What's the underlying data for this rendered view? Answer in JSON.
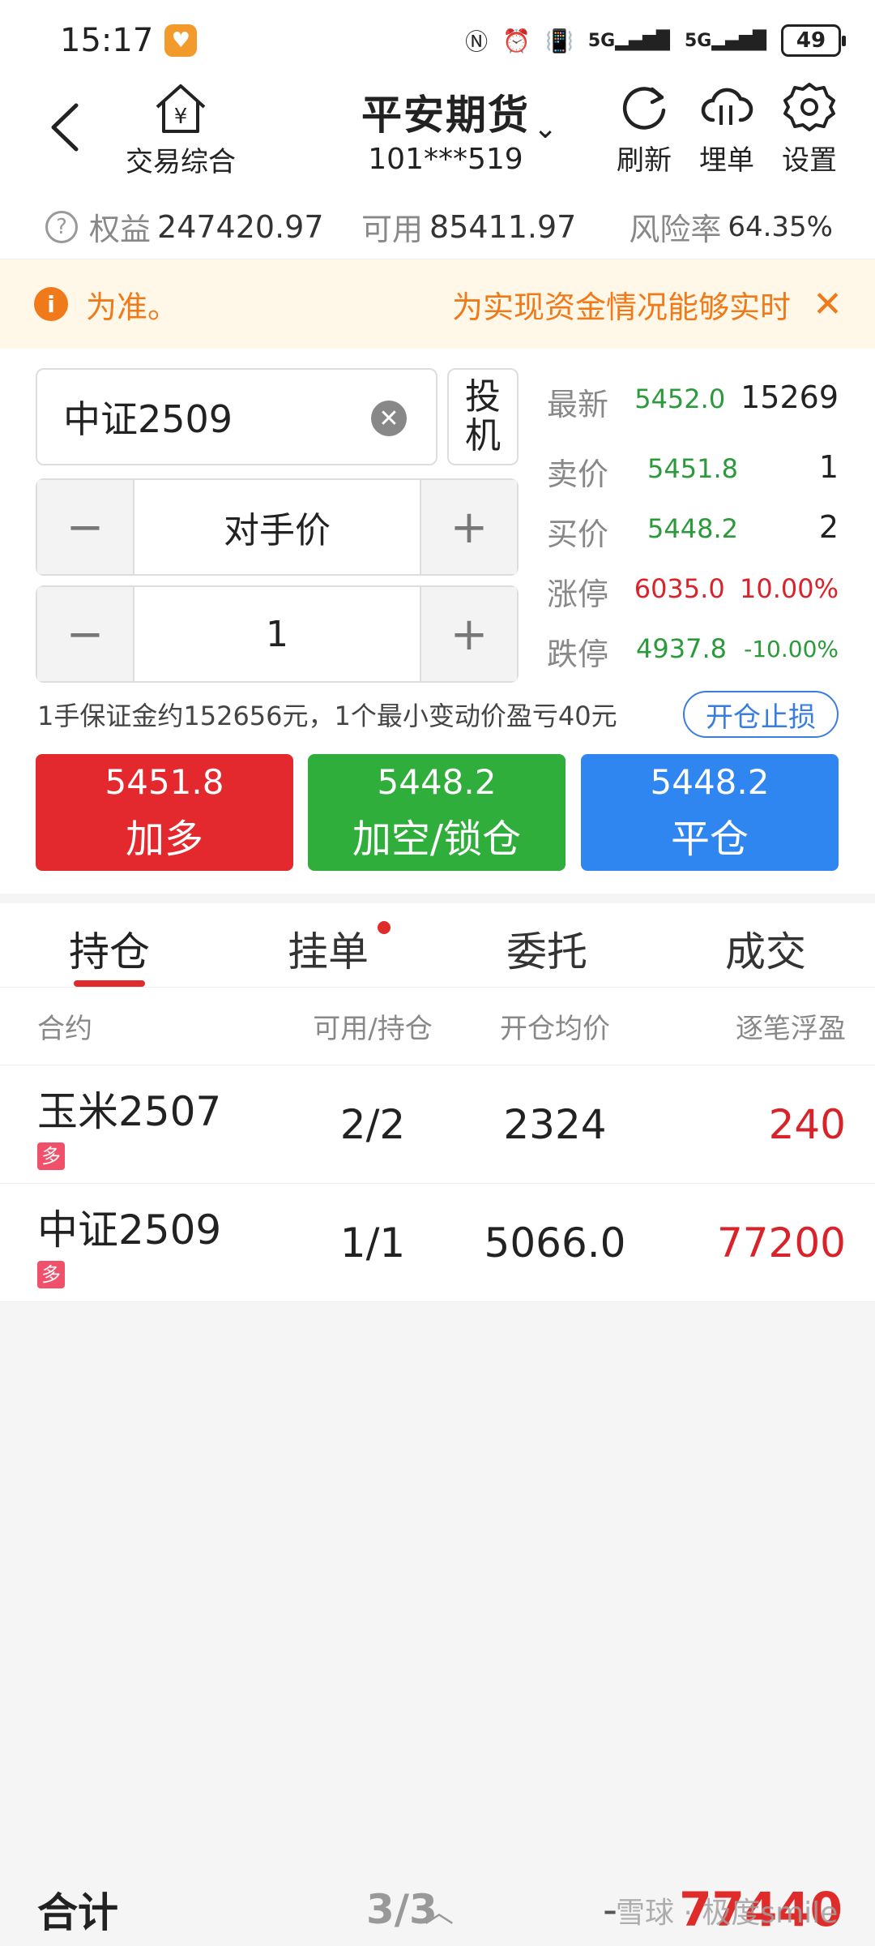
{
  "status_bar": {
    "time": "15:17",
    "network": "5G",
    "battery": "49"
  },
  "nav": {
    "home_label": "交易综合",
    "title": "平安期货",
    "account": "101***519",
    "refresh_label": "刷新",
    "bury_label": "埋单",
    "settings_label": "设置"
  },
  "account_bar": {
    "equity_label": "权益",
    "equity": "247420.97",
    "available_label": "可用",
    "available": "85411.97",
    "risk_label": "风险率",
    "risk": "64.35%"
  },
  "notice": {
    "left_text": "为准。",
    "right_text": "为实现资金情况能够实时"
  },
  "order": {
    "symbol": "中证2509",
    "spec_line1": "投",
    "spec_line2": "机",
    "price_type": "对手价",
    "quantity": "1",
    "minus": "−",
    "plus": "+",
    "info": "1手保证金约152656元，1个最小变动价盈亏40元",
    "stop_label": "开仓止损"
  },
  "quote": {
    "last_label": "最新",
    "last": "5452.0",
    "volume": "15269",
    "ask_label": "卖价",
    "ask": "5451.8",
    "ask_vol": "1",
    "bid_label": "买价",
    "bid": "5448.2",
    "bid_vol": "2",
    "limit_up_label": "涨停",
    "limit_up": "6035.0",
    "limit_up_pct": "10.00%",
    "limit_down_label": "跌停",
    "limit_down": "4937.8",
    "limit_down_pct": "-10.00%"
  },
  "trade_buttons": {
    "buy_price": "5451.8",
    "buy_label": "加多",
    "sell_price": "5448.2",
    "sell_label": "加空/锁仓",
    "close_price": "5448.2",
    "close_label": "平仓"
  },
  "colors": {
    "buy": "#e3292d",
    "sell": "#2fae3b",
    "close": "#2f86f0",
    "accent": "#e02b2b"
  },
  "tabs": [
    "持仓",
    "挂单",
    "委托",
    "成交"
  ],
  "table": {
    "headers": [
      "合约",
      "可用/持仓",
      "开仓均价",
      "逐笔浮盈"
    ],
    "rows": [
      {
        "name": "玉米2507",
        "tag": "多",
        "qty": "2/2",
        "avg": "2324",
        "pnl": "240"
      },
      {
        "name": "中证2509",
        "tag": "多",
        "qty": "1/1",
        "avg": "5066.0",
        "pnl": "77200"
      }
    ]
  },
  "footer": {
    "label": "合计",
    "page": "3/3",
    "dash": "-",
    "total": "77440",
    "watermark": "雪球 · 极度smile"
  }
}
